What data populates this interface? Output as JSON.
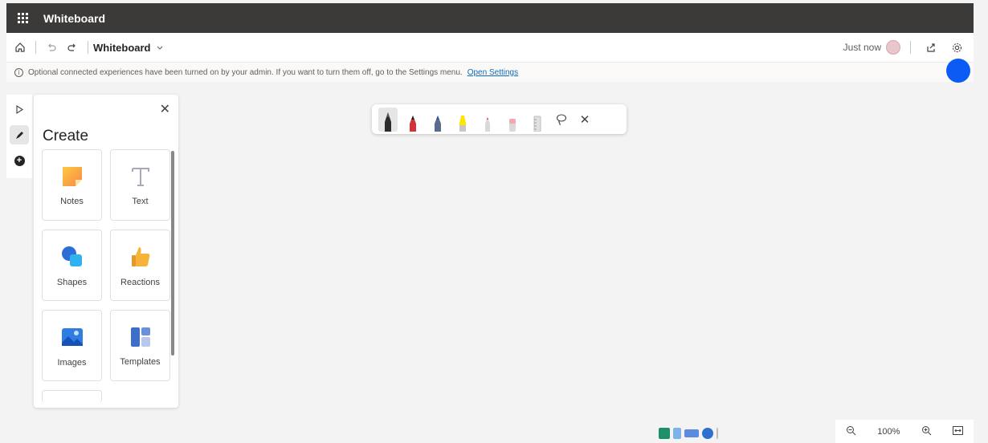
{
  "titlebar": {
    "app_title": "Whiteboard"
  },
  "cmdbar": {
    "doc_title": "Whiteboard",
    "save_status": "Just now"
  },
  "infobar": {
    "message": "Optional connected experiences have been turned on by your admin. If you want to turn them off, go to the Settings menu.",
    "link": "Open Settings"
  },
  "create_panel": {
    "title": "Create",
    "tiles": [
      {
        "label": "Notes",
        "icon": "sticky-note-icon"
      },
      {
        "label": "Text",
        "icon": "text-icon"
      },
      {
        "label": "Shapes",
        "icon": "shapes-icon"
      },
      {
        "label": "Reactions",
        "icon": "thumbs-up-icon"
      },
      {
        "label": "Images",
        "icon": "image-icon"
      },
      {
        "label": "Templates",
        "icon": "templates-icon"
      }
    ]
  },
  "pen_toolbar": {
    "pens": [
      {
        "name": "black-pen",
        "color": "#1f1f1f"
      },
      {
        "name": "red-pen",
        "color": "#d13438"
      },
      {
        "name": "blue-pen",
        "color": "#2f5597"
      },
      {
        "name": "yellow-highlighter",
        "color": "#ffe600"
      },
      {
        "name": "red-pencil",
        "color": "#e8a0a0"
      },
      {
        "name": "pink-eraser",
        "color": "#f4a7b0"
      },
      {
        "name": "ruler",
        "color": "#c8c8c8"
      }
    ]
  },
  "zoom": {
    "level": "100%"
  },
  "colors": {
    "accent": "#0a5cf5",
    "titlebar": "#3b3a39",
    "link": "#0f6cbd"
  }
}
